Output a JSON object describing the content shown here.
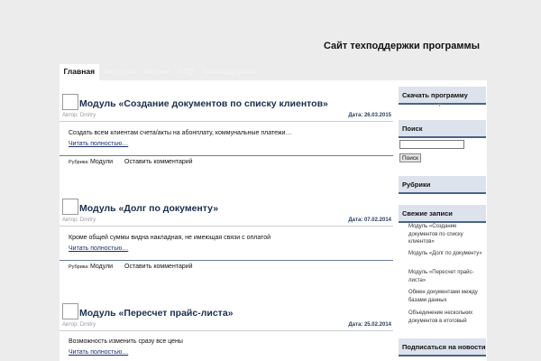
{
  "site": {
    "title": "Сайт техподдержки программы"
  },
  "nav": [
    {
      "label": "Главная",
      "active": true
    },
    {
      "label": "Загрузка",
      "active": false
    },
    {
      "label": "Форум",
      "active": false
    },
    {
      "label": "FAQ",
      "active": false
    },
    {
      "label": "Техподдержка",
      "active": false
    }
  ],
  "posts": [
    {
      "title": "Модуль «Создание документов по списку клиентов»",
      "author": "Автор: Dmitry",
      "date": "Дата: 26.03.2015",
      "excerpt": "Создать всем клиентам счета/акты на абонплату, коммунальные платежи…",
      "more": "Читать полностью…",
      "rubric_label": "Рубрика:",
      "rubric": "Модули",
      "comment": "Оставить комментарий"
    },
    {
      "title": "Модуль «Долг по документу»",
      "author": "Автор: Dmitry",
      "date": "Дата: 07.02.2014",
      "excerpt": "Кроме общей суммы видна накладная, не имеющая связи с оплатой",
      "more": "Читать полностью…",
      "rubric_label": "Рубрика:",
      "rubric": "Модули",
      "comment": "Оставить комментарий"
    },
    {
      "title": "Модуль «Пересчет прайс-листа»",
      "author": "Автор: Dmitry",
      "date": "Дата: 25.02.2014",
      "excerpt": "Возможность изменить сразу все цены",
      "more": "Читать полностью…"
    }
  ],
  "sidebar": {
    "download": "Скачать программу",
    "search_title": "Поиск",
    "search_value": "",
    "search_button": "Поиск",
    "rubrics": "Рубрики",
    "recent_title": "Свежие записи",
    "recent": [
      "Модуль «Создание документов по списку клиентов»",
      "Модуль «Долг по документу»",
      "Модуль «Пересчет прайс-листа»",
      "Обмен документами между базами данных",
      "Объединение нескольких документов в итоговый"
    ],
    "subscribe": "Подписаться на новости"
  },
  "colors": {
    "accent": "#4a6388",
    "title": "#1a2e4f",
    "widget_bg": "#dde3ec"
  }
}
